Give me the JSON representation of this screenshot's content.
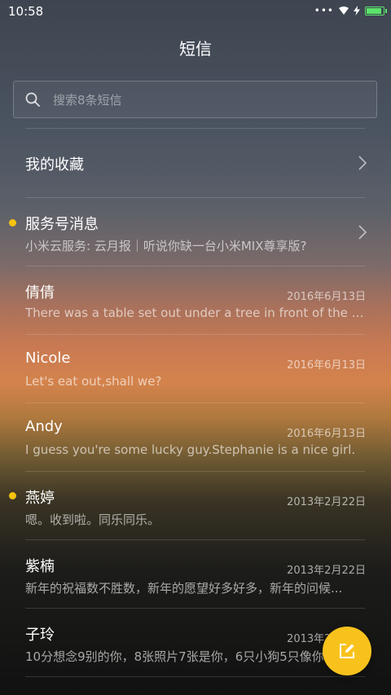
{
  "status_bar": {
    "time": "10:58",
    "more_dots": "•••"
  },
  "header": {
    "title": "短信"
  },
  "search": {
    "placeholder": "搜索8条短信"
  },
  "favorites": {
    "label": "我的收藏"
  },
  "messages": [
    {
      "name": "服务号消息",
      "date": "",
      "preview": "小米云服务: 云月报｜听说你缺一台小米MIX尊享版?",
      "unread": true
    },
    {
      "name": "倩倩",
      "date": "2016年6月13日",
      "preview": "There was a table set out under a tree in front of the ho...",
      "unread": false
    },
    {
      "name": "Nicole",
      "date": "2016年6月13日",
      "preview": "Let's eat out,shall we?",
      "unread": false
    },
    {
      "name": "Andy",
      "date": "2016年6月13日",
      "preview": "I guess you're some lucky guy.Stephanie is a nice girl.",
      "unread": false
    },
    {
      "name": "燕婷",
      "date": "2013年2月22日",
      "preview": "嗯。收到啦。同乐同乐。",
      "unread": true
    },
    {
      "name": "紫楠",
      "date": "2013年2月22日",
      "preview": "新年的祝福数不胜数，新年的愿望好多好多，新年的问候...",
      "unread": false
    },
    {
      "name": "子玲",
      "date": "2013年2月22日",
      "preview": "10分想念9别的你，8张照片7张是你，6只小狗5只像你...",
      "unread": false
    }
  ],
  "colors": {
    "accent": "#f8c21c",
    "unread_dot": "#f5c211",
    "battery": "#5be36a"
  },
  "icons": {
    "search": "search-icon",
    "chevron": "chevron-right-icon",
    "compose": "compose-icon"
  }
}
